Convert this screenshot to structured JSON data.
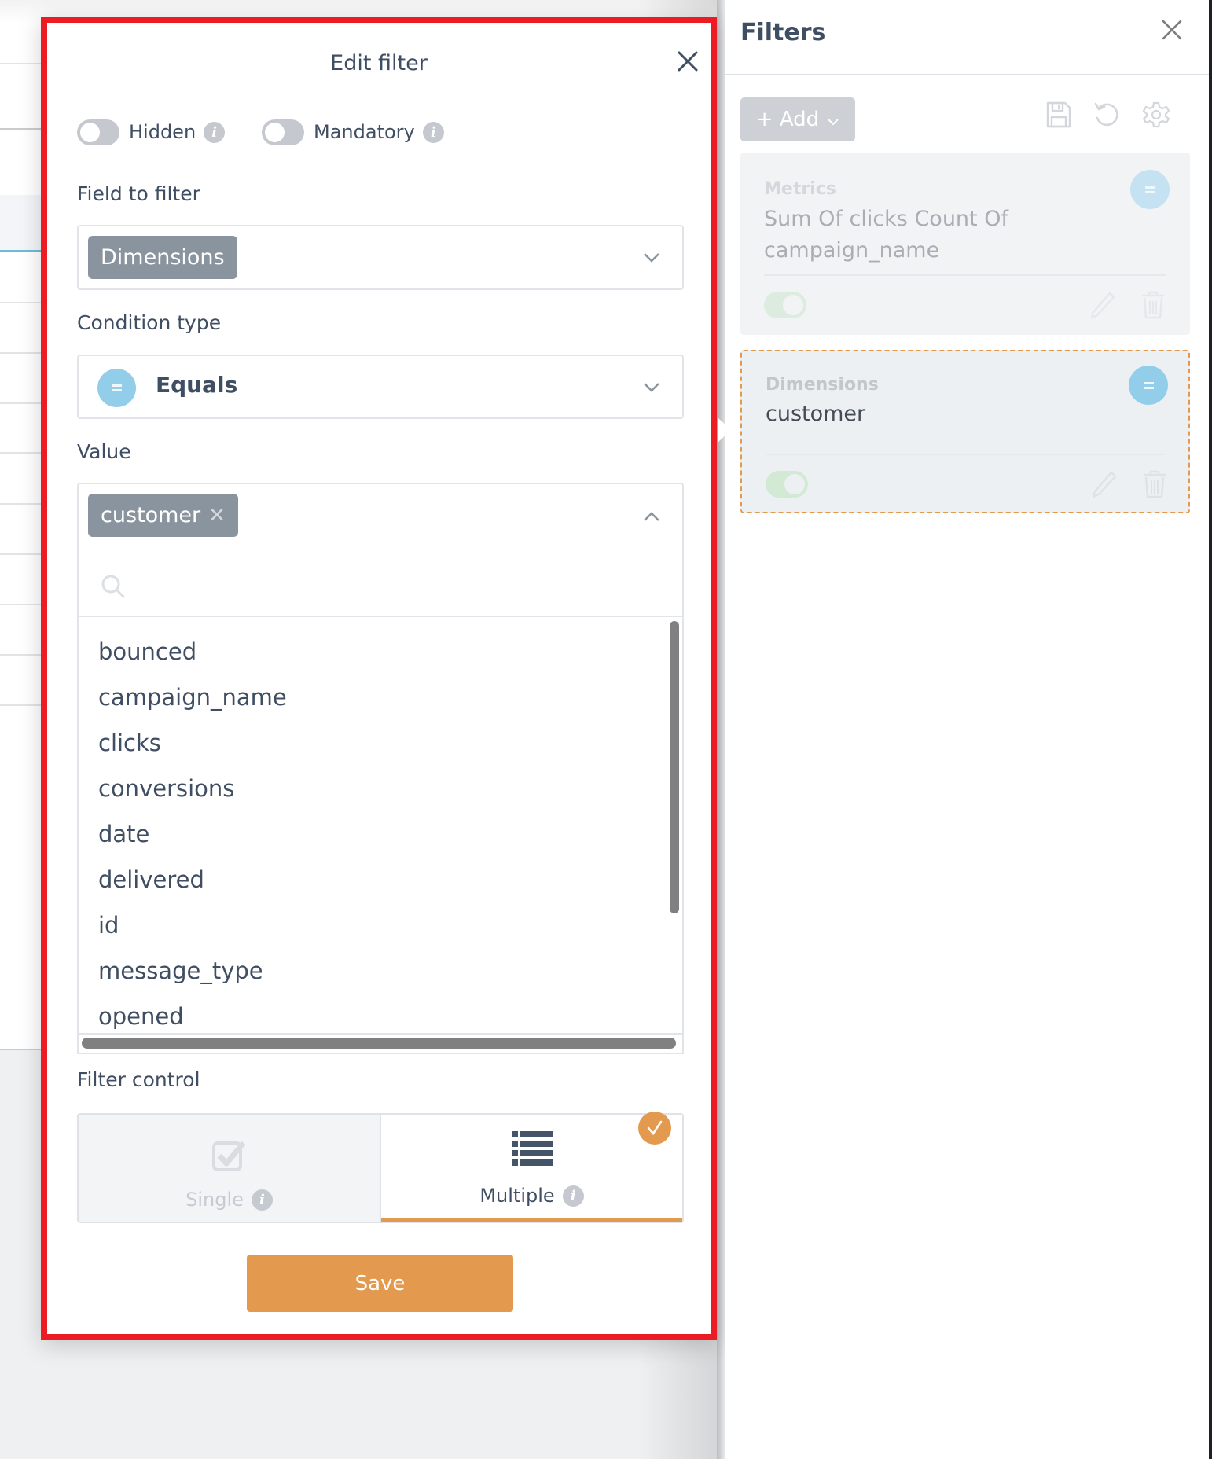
{
  "modal": {
    "title": "Edit filter",
    "toggles": [
      {
        "label": "Hidden",
        "on": false
      },
      {
        "label": "Mandatory",
        "on": false
      }
    ],
    "field_to_filter": {
      "label": "Field to filter",
      "selected": "Dimensions"
    },
    "condition_type": {
      "label": "Condition type",
      "selected": "Equals",
      "icon": "equals-icon"
    },
    "value": {
      "label": "Value",
      "selected_chips": [
        "customer"
      ],
      "search_placeholder": "",
      "options": [
        "bounced",
        "campaign_name",
        "clicks",
        "conversions",
        "date",
        "delivered",
        "id",
        "message_type",
        "opened"
      ]
    },
    "filter_control": {
      "label": "Filter control",
      "options": [
        {
          "label": "Single",
          "icon": "checkbox-icon",
          "selected": false
        },
        {
          "label": "Multiple",
          "icon": "list-icon",
          "selected": true
        }
      ]
    },
    "save_label": "Save"
  },
  "filters_panel": {
    "title": "Filters",
    "add_label": "+ Add",
    "tools": [
      "save-icon",
      "reset-icon",
      "settings-icon"
    ],
    "cards": [
      {
        "category": "Metrics",
        "value_line1": "Sum Of clicks Count Of",
        "value_line2": "campaign_name",
        "condition": "equals",
        "enabled": true,
        "active": false
      },
      {
        "category": "Dimensions",
        "value_line1": "customer",
        "value_line2": "",
        "condition": "equals",
        "enabled": true,
        "active": true
      }
    ]
  },
  "colors": {
    "accent": "#e39a4f",
    "highlight_border": "#ec1c24",
    "equals_badge": "#92cdea",
    "chip": "#8a949e",
    "text": "#3f4e62"
  }
}
